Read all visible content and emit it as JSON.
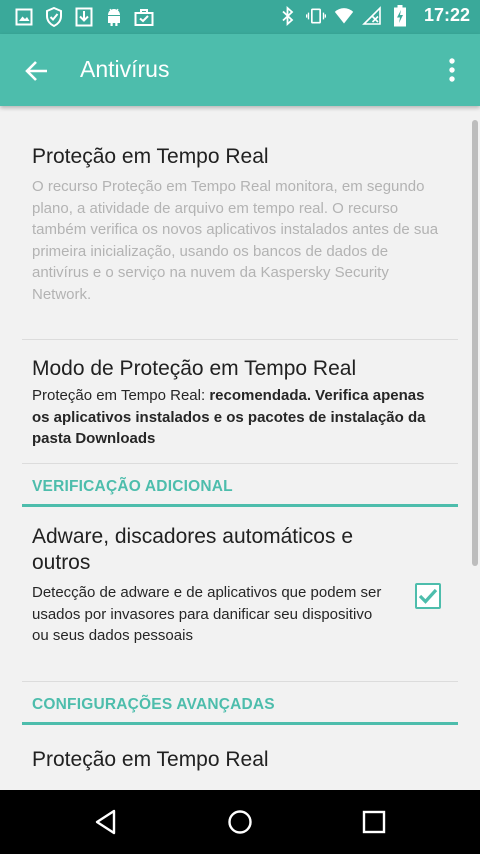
{
  "status_bar": {
    "time": "17:22",
    "left_icons": [
      "image-icon",
      "shield-icon",
      "download-icon",
      "android-icon",
      "briefcase-icon"
    ],
    "right_icons": [
      "bluetooth-icon",
      "vibrate-icon",
      "wifi-icon",
      "no-signal-icon",
      "battery-charging-icon"
    ]
  },
  "app_bar": {
    "title": "Antivírus"
  },
  "items": [
    {
      "title": "Proteção em Tempo Real",
      "description": "O recurso Proteção em Tempo Real monitora, em segundo plano, a atividade de arquivo em tempo real. O recurso também verifica os novos aplicativos instalados antes de sua primeira inicialização, usando os bancos de dados de antivírus e o serviço na nuvem da Kaspersky Security Network."
    },
    {
      "title": "Modo de Proteção em Tempo Real",
      "description_prefix": "Proteção em Tempo Real: ",
      "description_bold": "recomendada. Verifica apenas os aplicativos instalados e os pacotes de instalação da pasta Downloads"
    }
  ],
  "section_additional": {
    "header": "VERIFICAÇÃO ADICIONAL",
    "item": {
      "title": "Adware, discadores automáticos e outros",
      "description": "Detecção de adware e de aplicativos que podem ser usados por invasores para danificar seu dispositivo ou seus dados pessoais",
      "checked": true
    }
  },
  "section_advanced": {
    "header": "CONFIGURAÇÕES AVANÇADAS",
    "item": {
      "title": "Proteção em Tempo Real"
    }
  },
  "colors": {
    "accent": "#4dbdac",
    "status_bar": "#3aa99a"
  }
}
